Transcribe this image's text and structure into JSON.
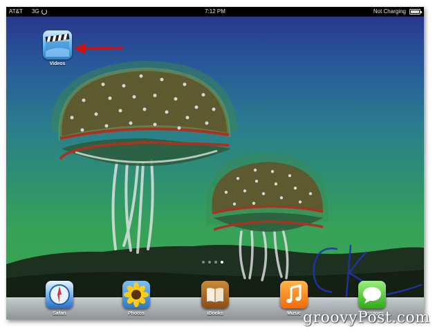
{
  "status_bar": {
    "carrier": "AT&T",
    "network": "3G",
    "time": "7:12 PM",
    "charging_status": "Not Charging",
    "icons": [
      "sync-icon",
      "battery-icon"
    ]
  },
  "home_screen": {
    "apps": [
      {
        "label": "Videos",
        "icon": "videos-clapperboard-icon"
      }
    ],
    "page_indicator": {
      "pages": 4,
      "current": 4
    }
  },
  "dock": {
    "apps": [
      {
        "label": "Safari",
        "icon": "safari-compass-icon"
      },
      {
        "label": "Photos",
        "icon": "sunflower-photo-icon"
      },
      {
        "label": "iBooks",
        "icon": "open-book-icon"
      },
      {
        "label": "Music",
        "icon": "music-note-icon"
      },
      {
        "label": "Messages",
        "icon": "speech-bubble-icon"
      }
    ]
  },
  "annotation": {
    "type": "arrow",
    "color": "#cc1111",
    "points_to": "Videos"
  },
  "colors": {
    "wallpaper_top": "#28318a",
    "wallpaper_bottom": "#3aa24f",
    "status_bar": "#000000"
  },
  "watermark": "groovyPost.com"
}
